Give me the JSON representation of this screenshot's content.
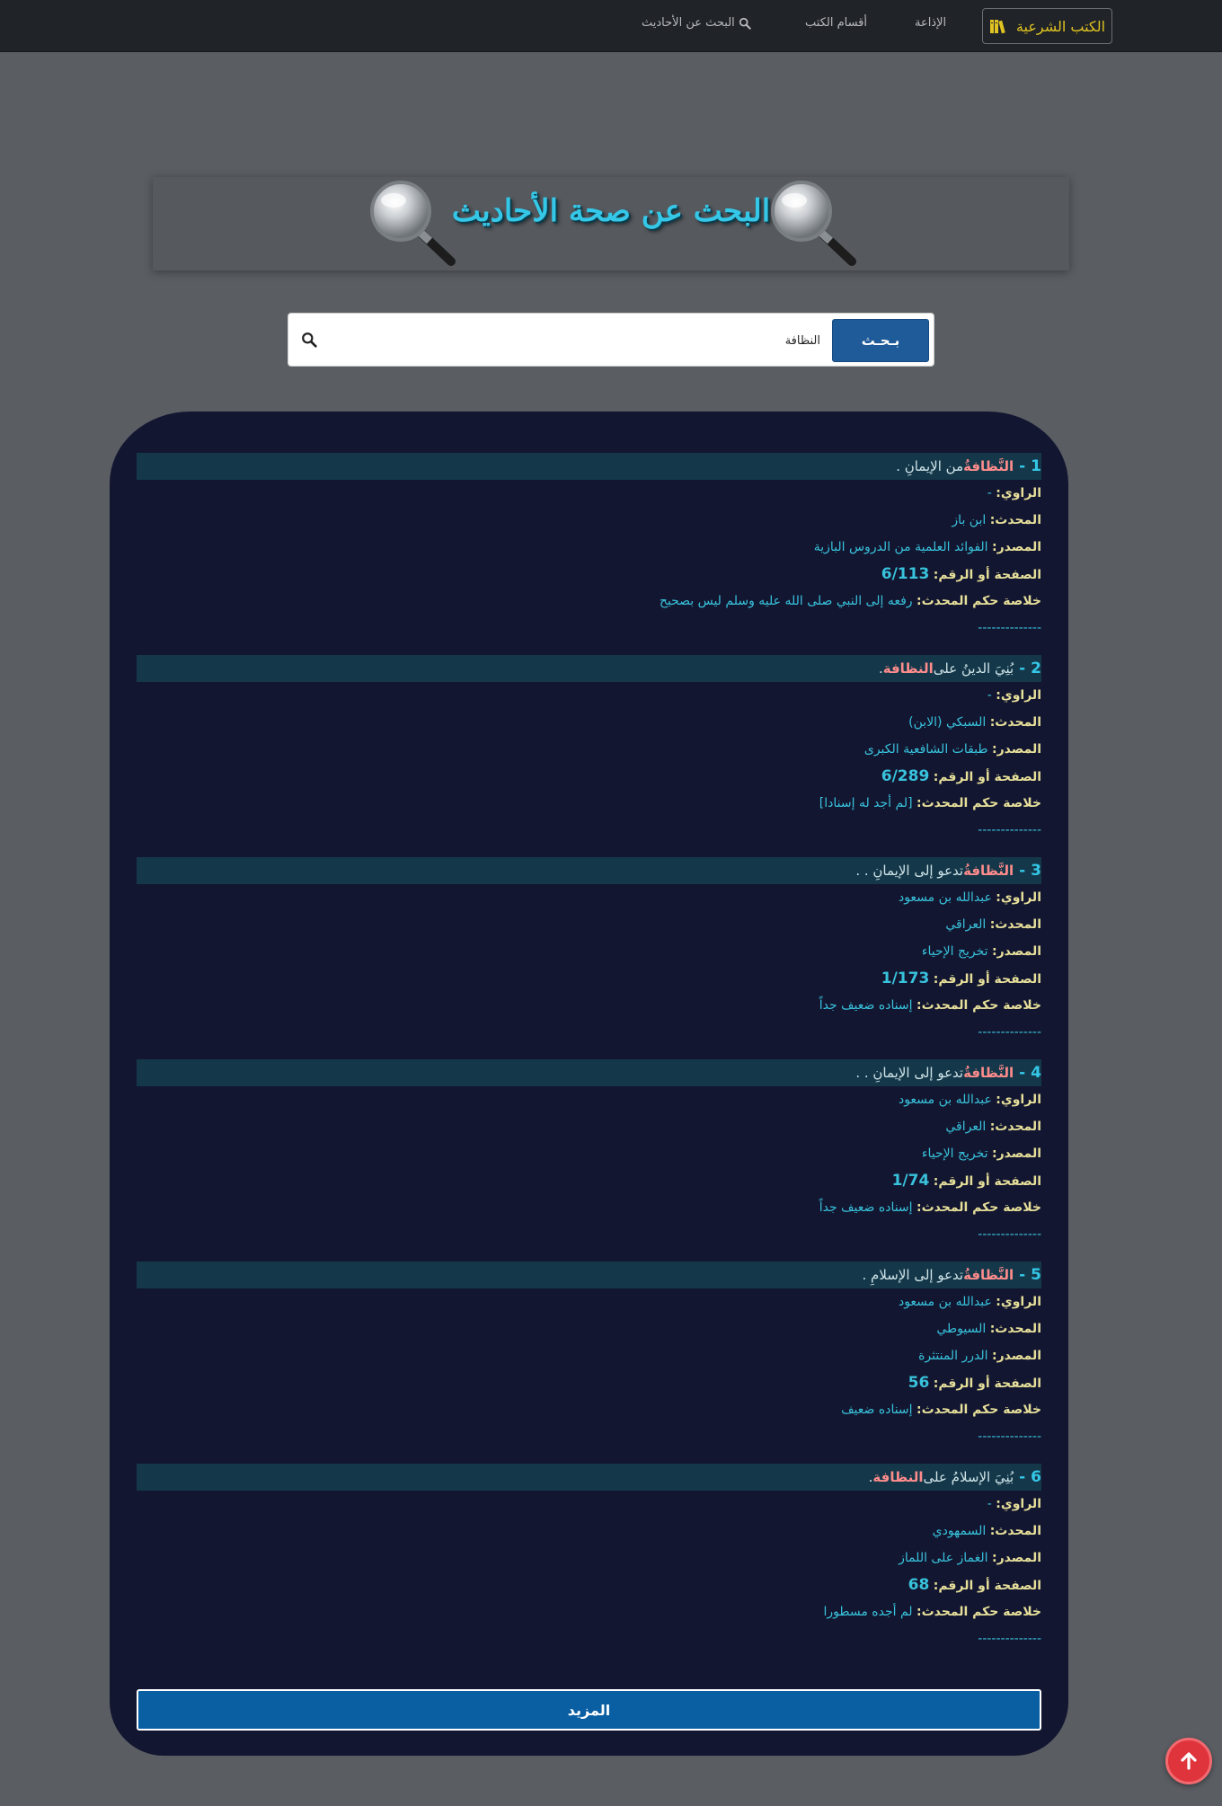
{
  "nav": {
    "brand_label": "الكتب الشرعية",
    "radio_label": "الإذاعة",
    "categories_label": "أقسام الكتب",
    "search_label": "البحث عن الأحاديث"
  },
  "banner": {
    "title": "البحث عن صحة الأحاديث"
  },
  "search": {
    "button_label": "بـحـث",
    "query": "النظافة"
  },
  "labels": {
    "narrator": "الراوي:",
    "scholar": "المحدث:",
    "source": "المصدر:",
    "page": "الصفحة أو الرقم:",
    "verdict": "خلاصة حكم المحدث:"
  },
  "separator": "--------------",
  "results": [
    {
      "number": "1 -",
      "keyword": "النَّظافةُ",
      "text_before": "",
      "text_after": " من الإيمانِ .",
      "narrator": "-",
      "scholar": "ابن باز",
      "source": "الفوائد العلمية من الدروس البازية",
      "page": "6/113",
      "verdict": "رفعه إلى النبي صلى الله عليه وسلم ليس بصحيح"
    },
    {
      "number": "2 -",
      "keyword": "النظافة",
      "text_before": "بُنِيَ الدينُ على ",
      "text_after": " .",
      "narrator": "-",
      "scholar": "السبكي (الابن)",
      "source": "طبقات الشافعية الكبرى",
      "page": "6/289",
      "verdict": "[لم أجد له إسنادا]"
    },
    {
      "number": "3 -",
      "keyword": "النَّظافةُ",
      "text_before": "",
      "text_after": " تدعو إلى الإيمانِ . .",
      "narrator": "عبدالله بن مسعود",
      "scholar": "العراقي",
      "source": "تخريج الإحياء",
      "page": "1/173",
      "verdict": "إسناده ضعيف جداً"
    },
    {
      "number": "4 -",
      "keyword": "النَّظافةُ",
      "text_before": "",
      "text_after": " تدعو إلى الإيمانِ . .",
      "narrator": "عبدالله بن مسعود",
      "scholar": "العراقي",
      "source": "تخريج الإحياء",
      "page": "1/74",
      "verdict": "إسناده ضعيف جداً"
    },
    {
      "number": "5 -",
      "keyword": "النَّظافةُ",
      "text_before": "",
      "text_after": " تدعو إلى الإسلامِ .",
      "narrator": "عبدالله بن مسعود",
      "scholar": "السيوطي",
      "source": "الدرر المنتثرة",
      "page": "56",
      "verdict": "إسناده ضعيف"
    },
    {
      "number": "6 -",
      "keyword": "النظافة",
      "text_before": "بُنِيَ الإسلامُ على ",
      "text_after": " .",
      "narrator": "-",
      "scholar": "السمهودي",
      "source": "الغماز على اللماز",
      "page": "68",
      "verdict": "لم أجده مسطورا"
    }
  ],
  "more_label": "المزيد",
  "colors": {
    "navbar": "#202327",
    "page_bg": "#5a5e63",
    "panel_bg": "#131630",
    "title_row_bg": "#14384a",
    "accent_cyan": "#35c7e7",
    "label_yellow": "#e6df9a",
    "highlight": "#ff8c8c",
    "button_blue": "#0a5fa3",
    "to_top_red": "#e0343d"
  },
  "icons": {
    "brand": "books-icon",
    "search_nav": "search-icon",
    "search_input": "search-icon",
    "to_top": "arrow-up-icon"
  }
}
